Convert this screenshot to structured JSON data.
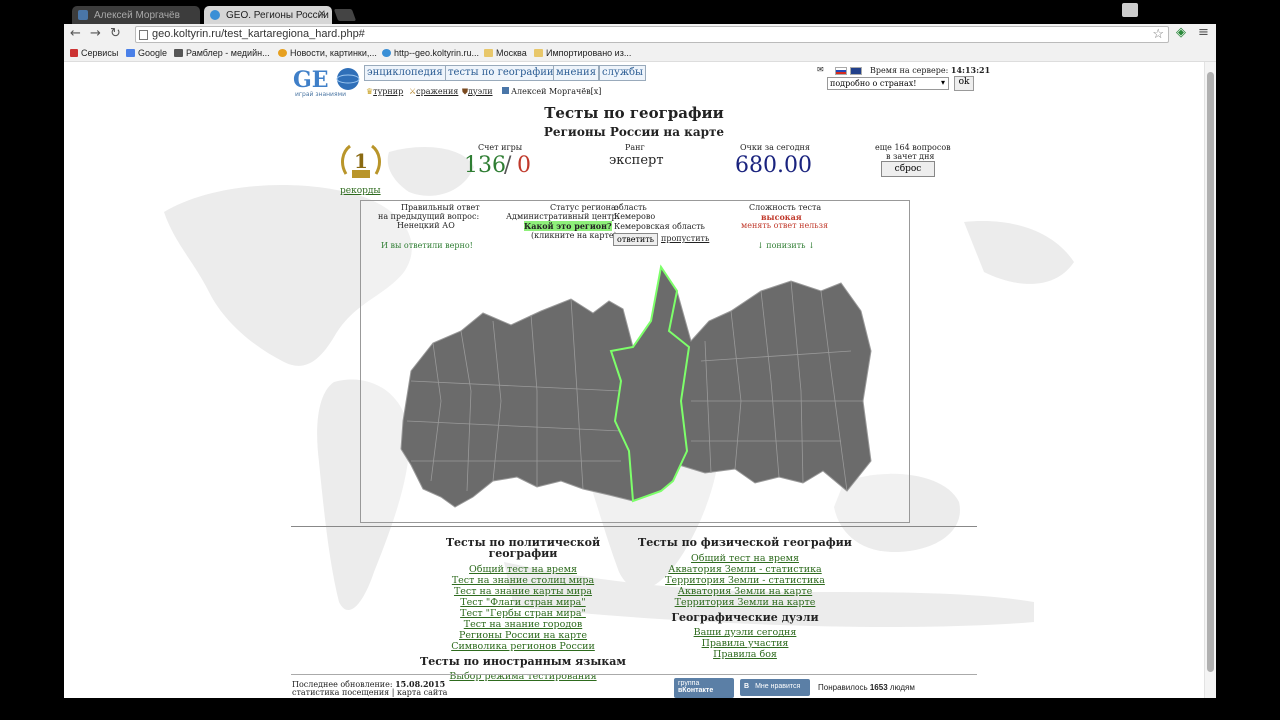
{
  "browser": {
    "tabs": [
      {
        "label": "Алексей Моргачёв",
        "active": false
      },
      {
        "label": "GEO. Регионы России (с)",
        "active": true
      }
    ],
    "url": "geo.koltyrin.ru/test_kartaregiona_hard.php#",
    "bookmarks": [
      "Сервисы",
      "Google",
      "Рамблер - медийн...",
      "Новости, картинки,...",
      "http--geo.koltyrin.ru...",
      "Москва",
      "Импортировано из..."
    ]
  },
  "site": {
    "logo_text": "GEO",
    "logo_tagline": "играй знаниями",
    "nav": [
      "энциклопедия",
      "тесты по географии",
      "мнения",
      "службы"
    ],
    "subnav": [
      "турнир",
      "сражения",
      "дуэли",
      "Алексей Моргачёв[x]"
    ],
    "server_time_label": "Время на сервере:",
    "server_time": "14:13:21",
    "select_value": "подробно о странах!",
    "ok": "ok"
  },
  "header": {
    "title": "Тесты по географии",
    "subtitle": "Регионы России на карте"
  },
  "stats": {
    "place": "1",
    "records": "рекорды",
    "score_label": "Счет игры",
    "score_right": "136",
    "score_sep": "/",
    "score_wrong": "0",
    "rank_label": "Ранг",
    "rank": "эксперт",
    "points_label": "Очки за сегодня",
    "points": "680.00",
    "remaining": "еще 164 вопросов",
    "remaining2": "в зачет дня",
    "reset": "сброс"
  },
  "panel": {
    "prev_label1": "Правильный ответ",
    "prev_label2": "на предыдущий вопрос:",
    "prev_answer": "Ненецкий АО",
    "result": "И вы ответили верно!",
    "status_label": "Статус региона:",
    "status": "область",
    "center_label": "Административный центр:",
    "center": "Кемерово",
    "question": "Какой это регион?",
    "hint": "(кликните на карте)",
    "answer": "Кемеровская область",
    "answer_btn": "ответить",
    "skip_btn": "пропустить",
    "difficulty_label": "Сложность теста",
    "difficulty": "высокая",
    "cant_change": "менять ответ нельзя",
    "lower": "↓ понизить ↓"
  },
  "links": {
    "political_title": "Тесты по политической географии",
    "political": [
      "Общий тест на время",
      "Тест на знание столиц мира",
      "Тест на знание карты мира",
      "Тест \"Флаги стран мира\"",
      "Тест \"Гербы стран мира\"",
      "Тест на знание городов",
      "Регионы России на карте",
      "Символика регионов России"
    ],
    "lang_title": "Тесты по иностранным языкам",
    "lang": [
      "Выбор режима тестирования"
    ],
    "physical_title": "Тесты по физической географии",
    "physical": [
      "Общий тест на время",
      "Акватория Земли - статистика",
      "Территория Земли - статистика",
      "Акватория Земли на карте",
      "Территория Земли на карте"
    ],
    "duels_title": "Географические дуэли",
    "duels": [
      "Ваши дуэли сегодня",
      "Правила участия",
      "Правила боя"
    ]
  },
  "footer": {
    "updated_label": "Последнее обновление:",
    "updated": "15.08.2015",
    "stats_link": "статистика посещения",
    "sep": "|",
    "map_link": "карта сайта",
    "vk_group1": "группа",
    "vk_group2": "вКонтакте",
    "vk_like": "Мне нравится",
    "liked_prefix": "Понравилось",
    "liked_count": "1653",
    "liked_suffix": "людям"
  }
}
